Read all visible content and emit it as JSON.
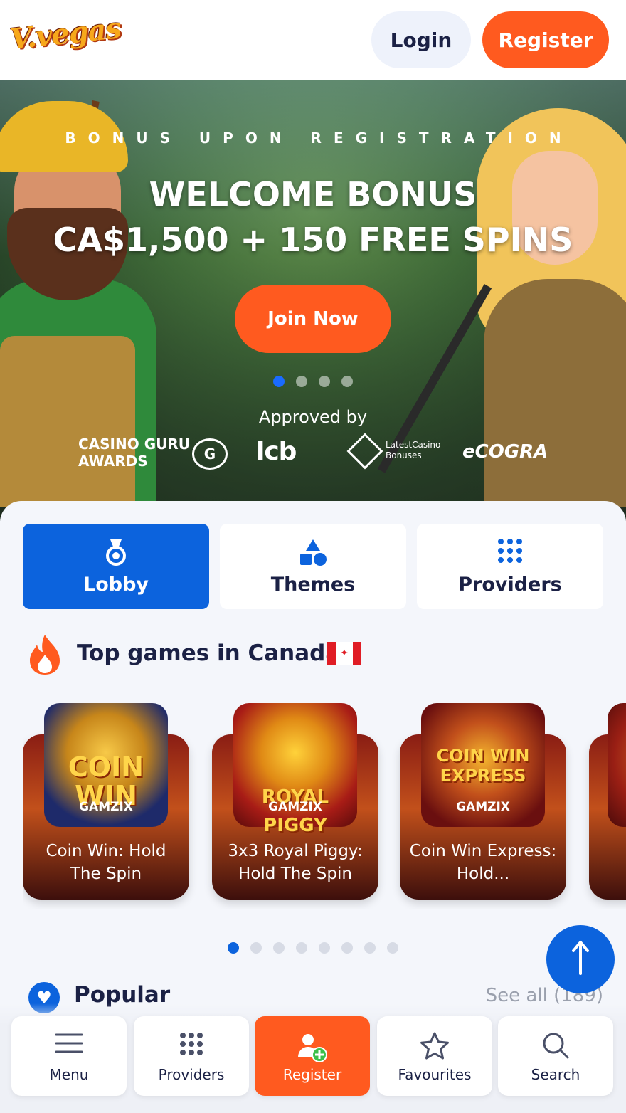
{
  "header": {
    "logo_text": "V.vegas",
    "login_label": "Login",
    "register_label": "Register"
  },
  "hero": {
    "subtitle": "BONUS UPON REGISTRATION",
    "title": "WELCOME BONUS",
    "amount": "CA$1,500 + 150 FREE SPINS",
    "cta_label": "Join Now",
    "slide_count": 4,
    "active_slide": 1,
    "approved_label": "Approved by",
    "partners": {
      "guru_line1": "CASINO GURU",
      "guru_line2": "AWARDS",
      "guru_badge": "G",
      "lcb": "lcb",
      "latest_line1": "LatestCasino",
      "latest_line2": "Bonuses",
      "ecogra": "eCOGRA"
    }
  },
  "categories": {
    "lobby": "Lobby",
    "themes": "Themes",
    "providers": "Providers",
    "active": "Lobby"
  },
  "top_games": {
    "title": "Top games in Canada",
    "games": [
      {
        "name": "Coin Win: Hold The Spin",
        "thumb_text": "COIN WIN",
        "brand": "GAMZIX"
      },
      {
        "name": "3x3 Royal Piggy: Hold The Spin",
        "thumb_text": "ROYAL PIGGY",
        "brand": "GAMZIX"
      },
      {
        "name": "Coin Win Express: Hold...",
        "thumb_text": "COIN WIN EXPRESS",
        "brand": "GAMZIX"
      }
    ],
    "page_count": 8,
    "active_page": 1
  },
  "popular": {
    "title": "Popular",
    "see_all": "See all (189)"
  },
  "bottom_nav": {
    "menu": "Menu",
    "providers": "Providers",
    "register": "Register",
    "favourites": "Favourites",
    "search": "Search"
  },
  "colors": {
    "accent_orange": "#ff5a1f",
    "accent_blue": "#0c63dd",
    "text_dark": "#1b2145"
  },
  "icons": [
    "medal-icon",
    "shapes-icon",
    "grid-icon",
    "flame-icon",
    "canada-flag-icon",
    "heart-icon",
    "arrow-up-icon",
    "menu-icon",
    "user-plus-icon",
    "star-icon",
    "search-icon"
  ]
}
